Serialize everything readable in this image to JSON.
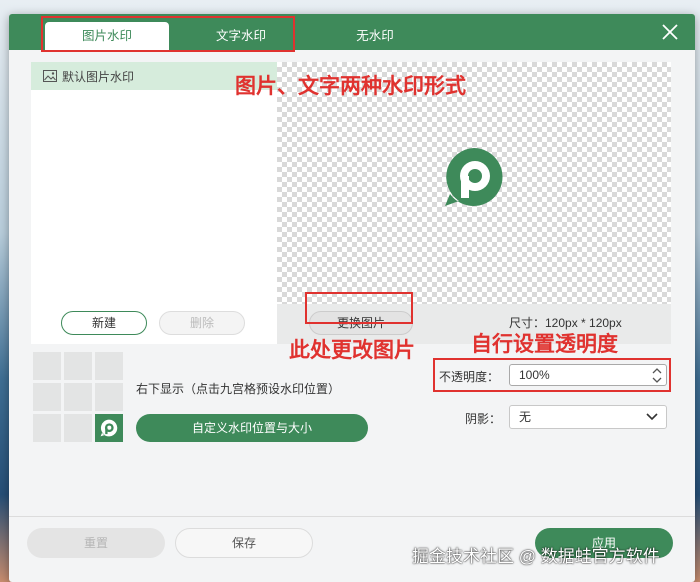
{
  "tabs": [
    {
      "label": "图片水印",
      "active": true
    },
    {
      "label": "文字水印",
      "active": false
    },
    {
      "label": "无水印",
      "active": false
    }
  ],
  "close_icon": "close-icon",
  "watermark_list": {
    "items": [
      {
        "label": "默认图片水印",
        "icon": "image-icon",
        "selected": true
      }
    ],
    "new_label": "新建",
    "delete_label": "删除"
  },
  "preview": {
    "logo_icon": "app-logo-icon",
    "change_image_label": "更换图片",
    "size_text": "尺寸：120px * 120px"
  },
  "position": {
    "selected_cell": "bottom-right",
    "description": "右下显示（点击九宫格预设水印位置）",
    "custom_button_label": "自定义水印位置与大小"
  },
  "settings": {
    "opacity_label": "不透明度：",
    "opacity_value": "100%",
    "shadow_label": "阴影：",
    "shadow_value": "无"
  },
  "footer": {
    "reset_label": "重置",
    "save_label": "保存",
    "apply_label": "应用"
  },
  "annotations": {
    "forms": "图片、文字两种水印形式",
    "change_here": "此处更改图片",
    "opacity_note": "自行设置透明度"
  },
  "credit": "掘金技术社区 @ 数据蛙官方软件",
  "colors": {
    "brand_green": "#3e8a5a",
    "annotation_red": "#e0322f",
    "selected_row": "#d6ecdc"
  }
}
